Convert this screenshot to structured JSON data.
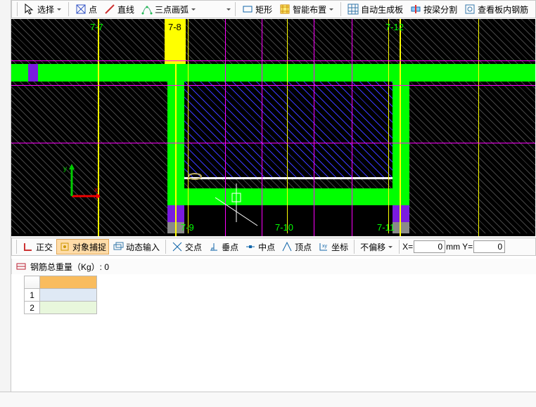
{
  "toolbar_top": {
    "select": "选择",
    "point": "点",
    "line": "直线",
    "arc3": "三点画弧",
    "rect": "矩形",
    "smart": "智能布置",
    "auto": "自动生成板",
    "split": "按梁分割",
    "view": "查看板内钢筋"
  },
  "toolbar_mid": {
    "ortho": "正交",
    "osnap": "对象捕捉",
    "dyn": "动态输入",
    "intpt": "交点",
    "perp": "垂点",
    "mid": "中点",
    "apex": "顶点",
    "coord": "坐标",
    "offset": "不偏移",
    "x_label": "X=",
    "x_val": "0",
    "mm": "mm",
    "y_label": "Y=",
    "y_val": "0"
  },
  "info": {
    "rebar_weight": "钢筋总重量（Kg）: 0"
  },
  "grid_labels": {
    "t1": "7-7",
    "t2": "7-8",
    "t3": "7-12",
    "b1": "7-9",
    "b2": "7-10",
    "b3": "7-11"
  },
  "sheet": {
    "row1": "1",
    "row2": "2"
  }
}
